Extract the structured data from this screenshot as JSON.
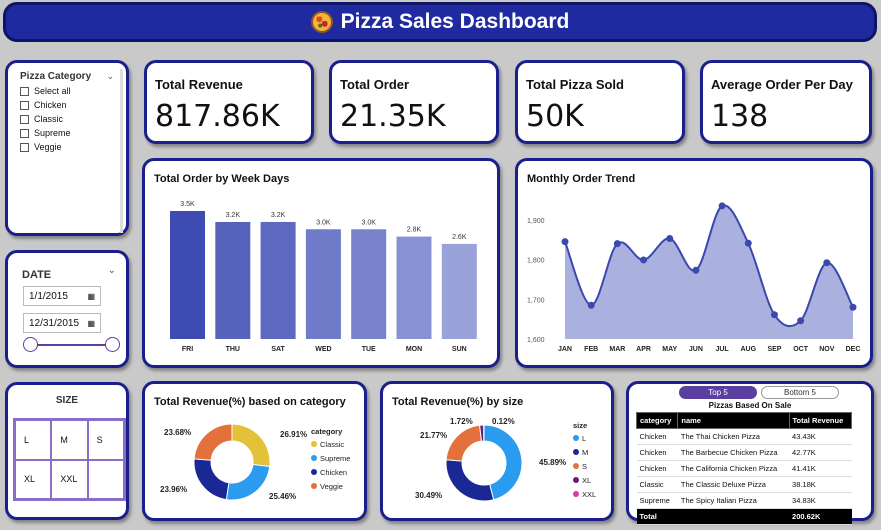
{
  "header": {
    "title": "Pizza Sales Dashboard"
  },
  "kpis": [
    {
      "title": "Total Revenue",
      "value": "817.86K"
    },
    {
      "title": "Total Order",
      "value": "21.35K"
    },
    {
      "title": "Total Pizza Sold",
      "value": "50K"
    },
    {
      "title": "Average Order Per Day",
      "value": "138"
    }
  ],
  "category_slicer": {
    "title": "Pizza Category",
    "options": [
      "Select all",
      "Chicken",
      "Classic",
      "Supreme",
      "Veggie"
    ]
  },
  "date_slicer": {
    "title": "DATE",
    "start": "1/1/2015",
    "end": "12/31/2015"
  },
  "size_slicer": {
    "title": "SIZE",
    "options": [
      "L",
      "M",
      "S",
      "XL",
      "XXL",
      ""
    ]
  },
  "colors": {
    "accent": "#1f2aa0",
    "purple": "#5b3fa0",
    "blue": "#2b9bf0",
    "navy": "#1a2896",
    "orange": "#e3713c",
    "yellow": "#e3c23a",
    "gray": "#c9c9c9"
  },
  "chart_data": [
    {
      "type": "bar",
      "title": "Total Order by Week Days",
      "categories": [
        "FRI",
        "THU",
        "SAT",
        "WED",
        "TUE",
        "MON",
        "SUN"
      ],
      "values": [
        3.5,
        3.2,
        3.2,
        3.0,
        3.0,
        2.8,
        2.6
      ],
      "labels": [
        "3.5K",
        "3.2K",
        "3.2K",
        "3.0K",
        "3.0K",
        "2.8K",
        "2.6K"
      ],
      "colors": [
        "#3d4bb3",
        "#5663bd",
        "#5d69c1",
        "#6f7ac8",
        "#7883cc",
        "#8891d3",
        "#9aa2da"
      ]
    },
    {
      "type": "area",
      "title": "Monthly Order Trend",
      "categories": [
        "JAN",
        "FEB",
        "MAR",
        "APR",
        "MAY",
        "JUN",
        "JUL",
        "AUG",
        "SEP",
        "OCT",
        "NOV",
        "DEC"
      ],
      "values": [
        1845,
        1685,
        1840,
        1799,
        1853,
        1773,
        1935,
        1841,
        1661,
        1646,
        1792,
        1680
      ],
      "yticks": [
        "1,600",
        "1,700",
        "1,800",
        "1,900"
      ],
      "ylim": [
        1600,
        1960
      ]
    },
    {
      "type": "pie",
      "title": "Total Revenue(%) based on category",
      "legend_title": "category",
      "slices": [
        {
          "name": "Classic",
          "value": 26.91,
          "label": "26.91%",
          "color": "#e3c23a"
        },
        {
          "name": "Supreme",
          "value": 25.46,
          "label": "25.46%",
          "color": "#2b9bf0"
        },
        {
          "name": "Chicken",
          "value": 23.96,
          "label": "23.96%",
          "color": "#1a2896"
        },
        {
          "name": "Veggie",
          "value": 23.68,
          "label": "23.68%",
          "color": "#e3713c"
        }
      ]
    },
    {
      "type": "pie",
      "title": "Total Revenue(%) by size",
      "legend_title": "size",
      "slices": [
        {
          "name": "L",
          "value": 45.89,
          "label": "45.89%",
          "color": "#2b9bf0"
        },
        {
          "name": "M",
          "value": 30.49,
          "label": "30.49%",
          "color": "#1a2896"
        },
        {
          "name": "S",
          "value": 21.77,
          "label": "21.77%",
          "color": "#e3713c"
        },
        {
          "name": "XL",
          "value": 1.72,
          "label": "1.72%",
          "color": "#6b1d74"
        },
        {
          "name": "XXL",
          "value": 0.12,
          "label": "0.12%",
          "color": "#d63ab0"
        }
      ]
    },
    {
      "type": "table",
      "title": "Pizzas Based On Sale",
      "columns": [
        "category",
        "name",
        "Total Revenue"
      ],
      "rows": [
        [
          "Chicken",
          "The Thai Chicken Pizza",
          "43.43K"
        ],
        [
          "Chicken",
          "The Barbecue Chicken Pizza",
          "42.77K"
        ],
        [
          "Chicken",
          "The California Chicken Pizza",
          "41.41K"
        ],
        [
          "Classic",
          "The Classic Deluxe Pizza",
          "38.18K"
        ],
        [
          "Supreme",
          "The Spicy Italian Pizza",
          "34.83K"
        ]
      ],
      "total": [
        "Total",
        "",
        "200.62K"
      ]
    }
  ],
  "table_tabs": {
    "active": "Top 5",
    "inactive": "Bottom 5"
  }
}
